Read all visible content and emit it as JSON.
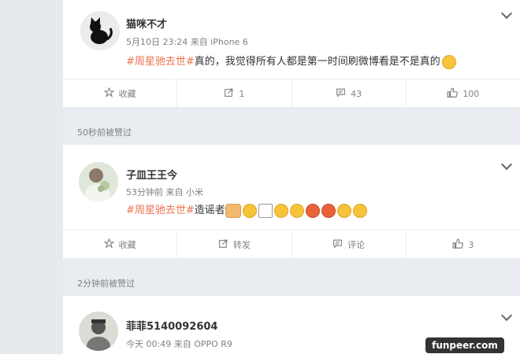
{
  "posts": [
    {
      "name": "猫咪不才",
      "meta": "5月10日 23:24 来自 iPhone 6",
      "topic": "#周星驰去世#",
      "text": "真的，我觉得所有人都是第一时间刷微博看是不是真的",
      "actions": {
        "favorite": "收藏",
        "repost": "1",
        "comment": "43",
        "like": "100"
      }
    },
    {
      "header": "50秒前被赞过",
      "name": "子皿王王今",
      "meta": "53分钟前 来自 小米",
      "topic": "#周星驰去世#",
      "text": "造谣者",
      "actions": {
        "favorite": "收藏",
        "repost": "转发",
        "comment": "评论",
        "like": "3"
      }
    },
    {
      "header": "2分钟前被赞过",
      "name": "菲菲5140092604",
      "meta": "今天 00:49 来自 OPPO R9"
    }
  ],
  "watermark": "funpeer.com",
  "colors": {
    "topic": "#eb7350",
    "page_bg": "#e9ecf1"
  }
}
